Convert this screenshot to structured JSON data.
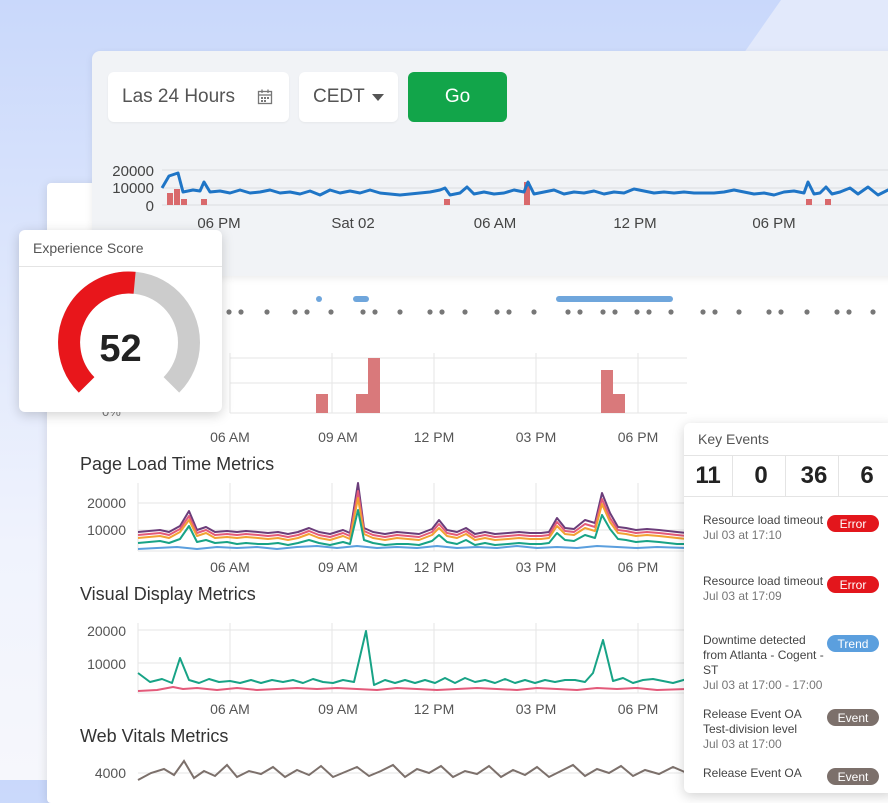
{
  "controls": {
    "time_range": "Las 24 Hours",
    "timezone": "CEDT",
    "go_label": "Go"
  },
  "overview_chart": {
    "y_ticks": [
      "20000",
      "10000",
      "0"
    ],
    "x_ticks": [
      "06 PM",
      "Sat 02",
      "06 AM",
      "12 PM",
      "06 PM"
    ],
    "colors": {
      "line": "#1f75c6",
      "bars": "#d9696c"
    }
  },
  "time_axis": [
    "06 AM",
    "09 AM",
    "12 PM",
    "03 PM",
    "06 PM"
  ],
  "bar_axis_fragment": "0%",
  "sections": {
    "page_load": {
      "title": "Page Load Time Metrics",
      "y_ticks": [
        "20000",
        "10000"
      ]
    },
    "visual_display": {
      "title": "Visual Display Metrics",
      "y_ticks": [
        "20000",
        "10000"
      ]
    },
    "web_vitals": {
      "title": "Web Vitals Metrics",
      "y_ticks": [
        "4000"
      ]
    }
  },
  "experience_score": {
    "title": "Experience Score",
    "value": "52",
    "value_fraction": 0.52,
    "colors": {
      "filled": "#e8161b",
      "remaining": "#cccccc"
    }
  },
  "key_events": {
    "title": "Key Events",
    "counts": [
      "11",
      "0",
      "36",
      "6"
    ],
    "items": [
      {
        "title": "Resource load timeout",
        "time": "Jul 03 at 17:10",
        "badge": "Error",
        "badge_color": "#e3161c"
      },
      {
        "title": "Resource load timeout",
        "time": "Jul 03 at 17:09",
        "badge": "Error",
        "badge_color": "#e3161c"
      },
      {
        "title": "Downtime detected from Atlanta - Cogent -ST",
        "time": "Jul 03 at 17:00 - 17:00",
        "badge": "Trend",
        "badge_color": "#5b9fde"
      },
      {
        "title": "Release Event OA Test-division level",
        "time": "Jul 03 at 17:00",
        "badge": "Event",
        "badge_color": "#7c706b"
      },
      {
        "title": "Release Event OA",
        "time": "",
        "badge": "Event",
        "badge_color": "#7c706b"
      }
    ]
  }
}
